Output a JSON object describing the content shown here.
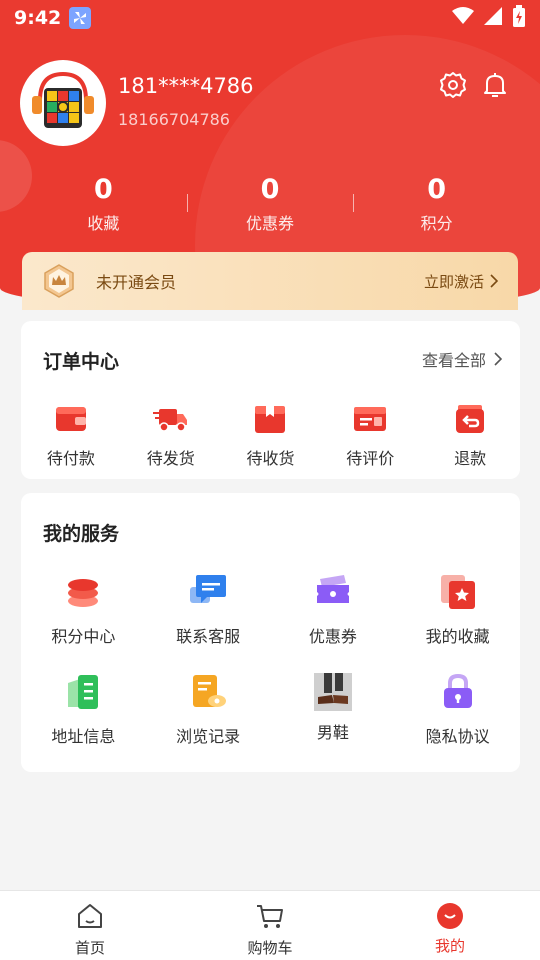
{
  "status_bar": {
    "time": "9:42"
  },
  "profile": {
    "username": "181****4786",
    "phone": "18166704786"
  },
  "stats": [
    {
      "value": "0",
      "label": "收藏"
    },
    {
      "value": "0",
      "label": "优惠券"
    },
    {
      "value": "0",
      "label": "积分"
    }
  ],
  "vip": {
    "text": "未开通会员",
    "action": "立即激活"
  },
  "orders": {
    "title": "订单中心",
    "more": "查看全部",
    "items": [
      {
        "label": "待付款",
        "icon": "wallet-icon"
      },
      {
        "label": "待发货",
        "icon": "truck-icon"
      },
      {
        "label": "待收货",
        "icon": "package-icon"
      },
      {
        "label": "待评价",
        "icon": "review-icon"
      },
      {
        "label": "退款",
        "icon": "refund-icon"
      }
    ]
  },
  "services": {
    "title": "我的服务",
    "items": [
      {
        "label": "积分中心",
        "icon": "coins-icon"
      },
      {
        "label": "联系客服",
        "icon": "chat-icon"
      },
      {
        "label": "优惠券",
        "icon": "coupon-icon"
      },
      {
        "label": "我的收藏",
        "icon": "favorite-icon"
      },
      {
        "label": "地址信息",
        "icon": "address-icon"
      },
      {
        "label": "浏览记录",
        "icon": "history-icon"
      },
      {
        "label": "男鞋",
        "icon": "shoes-image"
      },
      {
        "label": "隐私协议",
        "icon": "lock-icon"
      }
    ]
  },
  "tabs": [
    {
      "label": "首页",
      "icon": "home-icon"
    },
    {
      "label": "购物车",
      "icon": "cart-icon"
    },
    {
      "label": "我的",
      "icon": "profile-icon"
    }
  ],
  "colors": {
    "brand": "#ea3a30",
    "vip_text": "#7a4a12"
  }
}
